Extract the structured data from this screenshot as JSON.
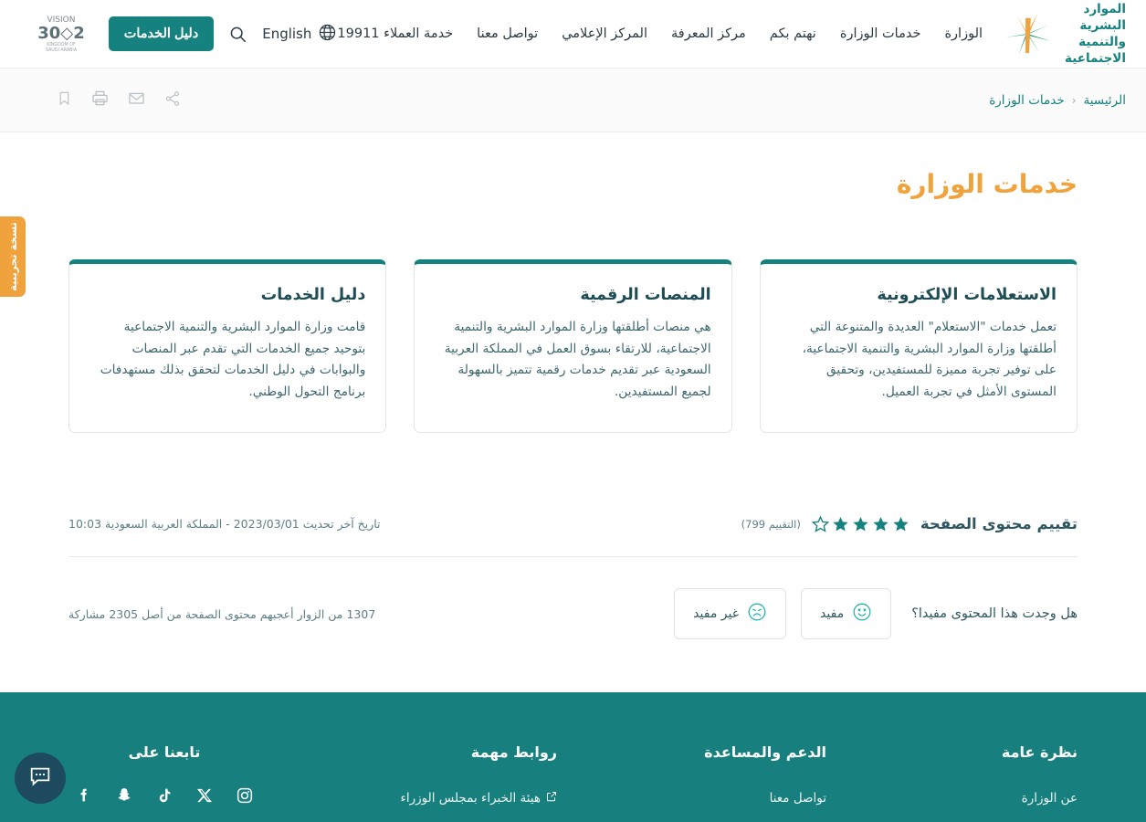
{
  "header": {
    "brand_name": "الموارد البشرية\nوالتنمية الاجتماعية",
    "brand_logo_icon": "ministry-star-logo",
    "nav_items": [
      {
        "label": "الوزارة"
      },
      {
        "label": "خدمات الوزارة"
      },
      {
        "label": "نهتم بكم"
      },
      {
        "label": "مركز المعرفة"
      },
      {
        "label": "المركز الإعلامي"
      },
      {
        "label": "تواصل معنا"
      },
      {
        "label": "خدمة العملاء 19911"
      }
    ],
    "language_label": "English",
    "language_icon": "globe-icon",
    "search_icon": "search-icon",
    "services_button": "دليل الخدمات",
    "vision_logo": "vision-2030-logo",
    "vision_logo_text": "VISION 2030 KINGDOM OF SAUDI ARABIA"
  },
  "breadcrumb": {
    "items": [
      {
        "label": "الرئيسية"
      },
      {
        "label": "خدمات الوزارة"
      }
    ],
    "separator": "‹"
  },
  "tools": [
    {
      "name": "share-icon"
    },
    {
      "name": "email-icon"
    },
    {
      "name": "print-icon"
    },
    {
      "name": "bookmark-icon"
    }
  ],
  "beta": {
    "label": "نسخة تجريبية"
  },
  "main": {
    "page_title": "خدمات الوزارة",
    "cards": [
      {
        "title": "دليل الخدمات",
        "body": "قامت وزارة الموارد البشرية والتنمية الاجتماعية بتوحيد جميع الخدمات التي تقدم عبر المنصات والبوابات في دليل الخدمات لتحقق بذلك مستهدفات برنامج التحول الوطني."
      },
      {
        "title": "المنصات الرقمية",
        "body": "هي منصات أطلقتها وزارة الموارد البشرية والتنمية الاجتماعية، للارتقاء بسوق العمل في المملكة العربية السعودية عبر تقديم خدمات رقمية تتميز بالسهولة لجميع المستفيدين."
      },
      {
        "title": "الاستعلامات الإلكترونية",
        "body": "تعمل خدمات \"الاستعلام\" العديدة والمتنوعة التي أطلقتها وزارة الموارد البشرية والتنمية الاجتماعية، على توفير تجربة مميزة للمستفيدين، وتحقيق المستوى الأمثل في تجربة العميل."
      }
    ]
  },
  "rating": {
    "label": "تقييم محتوى الصفحة",
    "stars_filled": 4,
    "stars_total": 5,
    "count_label": "(التقييم 799)",
    "star_color": "#15827f",
    "updated_text": "تاريخ آخر تحديث  2023/03/01  -  المملكة العربية السعودية  10:03"
  },
  "feedback": {
    "question": "هل وجدت هذا المحتوى مفيدا؟",
    "useful_label": "مفيد",
    "useful_icon": "smiley-face-icon",
    "not_useful_label": "غير مفيد",
    "not_useful_icon": "sad-face-icon",
    "stats": "1307 من الزوار أعجبهم محتوى الصفحة من أصل 2305 مشاركة"
  },
  "footer": {
    "overview": {
      "title": "نظرة عامة",
      "links": [
        {
          "label": "عن الوزارة"
        }
      ]
    },
    "support": {
      "title": "الدعم والمساعدة",
      "links": [
        {
          "label": "تواصل معنا"
        }
      ]
    },
    "important_links": {
      "title": "روابط مهمة",
      "links": [
        {
          "label": "هيئة الخبراء بمجلس الوزراء",
          "icon": "external-link-icon"
        }
      ]
    },
    "follow": {
      "title": "تابعنا على",
      "socials": [
        {
          "name": "instagram-icon"
        },
        {
          "name": "x-twitter-icon"
        },
        {
          "name": "tiktok-icon"
        },
        {
          "name": "snapchat-icon"
        },
        {
          "name": "facebook-icon"
        }
      ]
    },
    "background_color": "#17807e"
  },
  "chat": {
    "icon": "chat-bubble-icon",
    "color": "#1d4a5e"
  }
}
